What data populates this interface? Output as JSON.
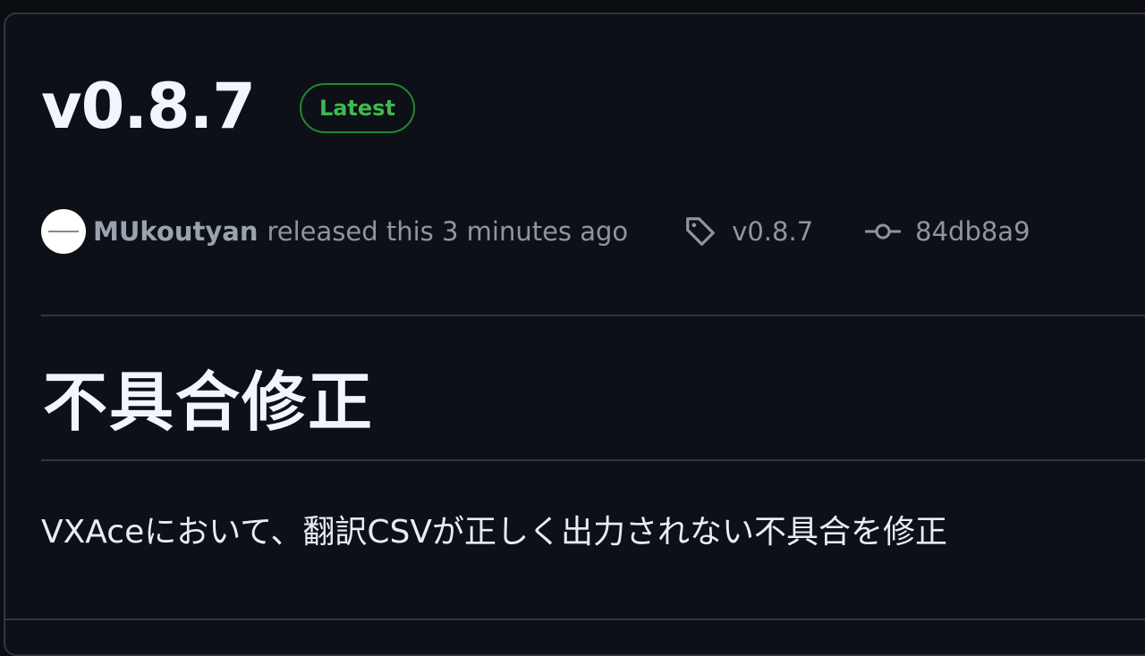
{
  "release": {
    "title": "v0.8.7",
    "badge": "Latest",
    "author": "MUkoutyan",
    "released_text": "released this 3 minutes ago",
    "tag": "v0.8.7",
    "commit": "84db8a9",
    "icons": {
      "avatar": "avatar",
      "tag": "tag-icon",
      "commit": "git-commit-icon"
    }
  },
  "notes": {
    "heading": "不具合修正",
    "body": "VXAceにおいて、翻訳CSVが正しく出力されない不具合を修正"
  },
  "colors": {
    "background": "#0d1117",
    "border": "#30363d",
    "latest_badge": "#3fb950",
    "muted_text": "#8d96a0",
    "heading_text": "#f0f6fc"
  }
}
